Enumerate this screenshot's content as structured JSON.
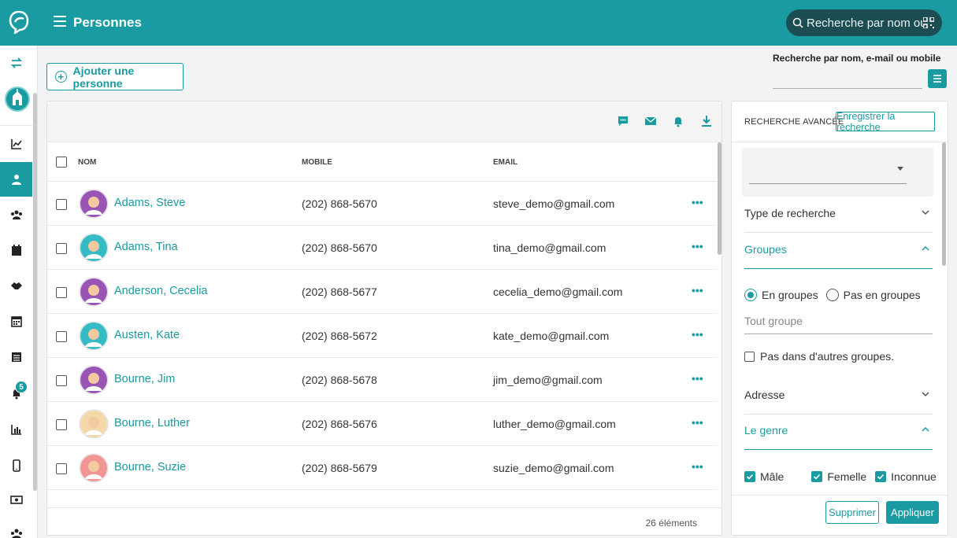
{
  "header": {
    "title": "Personnes",
    "search_placeholder": "Recherche par nom ou …"
  },
  "sidebar": {
    "notification_badge": "5",
    "items": [
      "swap-icon",
      "org-icon",
      "chart-icon",
      "person-icon",
      "group-icon",
      "calendar-icon",
      "handshake-icon",
      "calendar-grid-icon",
      "list-icon",
      "bell-icon",
      "bar-chart-icon",
      "mobile-icon",
      "money-icon",
      "people-icon"
    ]
  },
  "actions": {
    "add_person": "Ajouter une personne",
    "quick_search_label": "Recherche par nom, e-mail ou mobile"
  },
  "table": {
    "columns": {
      "name": "NOM",
      "mobile": "MOBILE",
      "email": "EMAIL"
    },
    "rows": [
      {
        "name": "Adams, Steve",
        "mobile": "(202) 868-5670",
        "email": "steve_demo@gmail.com",
        "avatar_color": "#8e44ad"
      },
      {
        "name": "Adams, Tina",
        "mobile": "(202) 868-5670",
        "email": "tina_demo@gmail.com",
        "avatar_color": "#1fb5c0"
      },
      {
        "name": "Anderson, Cecelia",
        "mobile": "(202) 868-5677",
        "email": "cecelia_demo@gmail.com",
        "avatar_color": "#8e44ad"
      },
      {
        "name": "Austen, Kate",
        "mobile": "(202) 868-5672",
        "email": "kate_demo@gmail.com",
        "avatar_color": "#1fb5c0"
      },
      {
        "name": "Bourne, Jim",
        "mobile": "(202) 868-5678",
        "email": "jim_demo@gmail.com",
        "avatar_color": "#8e44ad"
      },
      {
        "name": "Bourne, Luther",
        "mobile": "(202) 868-5676",
        "email": "luther_demo@gmail.com",
        "avatar_color": "#f5d5a0"
      },
      {
        "name": "Bourne, Suzie",
        "mobile": "(202) 868-5679",
        "email": "suzie_demo@gmail.com",
        "avatar_color": "#f08a8a"
      }
    ],
    "footer_count": "26 éléments"
  },
  "advanced": {
    "title": "RECHERCHE AVANCÉE",
    "save_button": "Enregistrer la recherche",
    "sections": {
      "search_type": "Type de recherche",
      "groups": "Groupes",
      "address": "Adresse",
      "gender": "Le genre"
    },
    "radio_in_groups": "En groupes",
    "radio_not_in_groups": "Pas en groupes",
    "group_placeholder": "Tout groupe",
    "not_in_other_groups": "Pas dans d'autres groupes.",
    "gender_options": [
      "Mâle",
      "Femelle",
      "Inconnue"
    ],
    "delete_button": "Supprimer",
    "apply_button": "Appliquer"
  },
  "colors": {
    "accent": "#1a9ba1",
    "search_bg": "#1b4d52"
  }
}
